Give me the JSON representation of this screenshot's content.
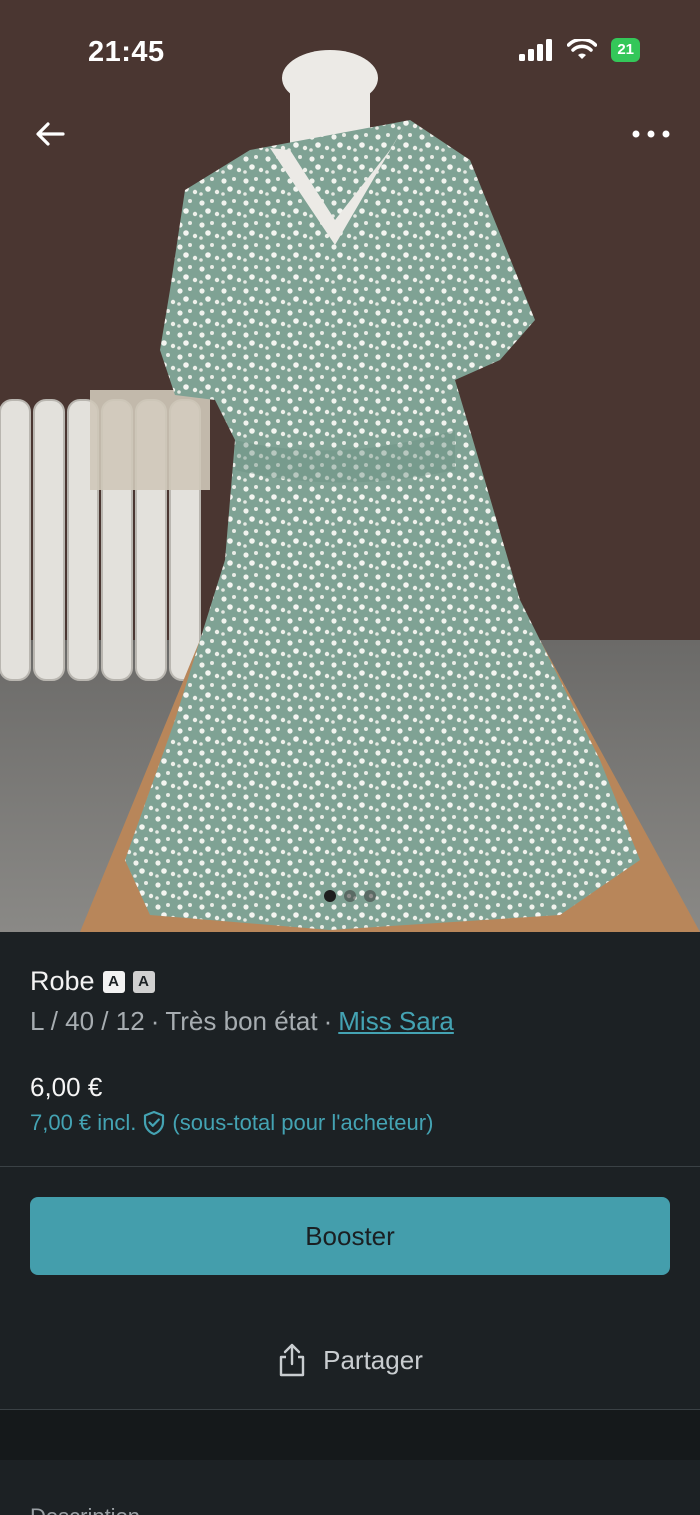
{
  "status_bar": {
    "time": "21:45",
    "battery": "21"
  },
  "gallery": {
    "photo_count": 3,
    "active_index": 0
  },
  "item": {
    "title": "Robe",
    "size": "L / 40 / 12",
    "condition": "Très bon état",
    "seller": "Miss Sara",
    "price": "6,00 €",
    "price_incl": "7,00 € incl.",
    "price_incl_note": "(sous-total pour l'acheteur)"
  },
  "actions": {
    "boost_label": "Booster",
    "share_label": "Partager"
  },
  "sections": {
    "description_label": "Description"
  },
  "colors": {
    "accent": "#449eac",
    "background": "#1c2124",
    "link": "#44a3b3"
  },
  "icons": [
    "signal-icon",
    "wifi-icon",
    "battery-icon",
    "back-arrow-icon",
    "more-icon",
    "shield-check-icon",
    "share-icon"
  ]
}
